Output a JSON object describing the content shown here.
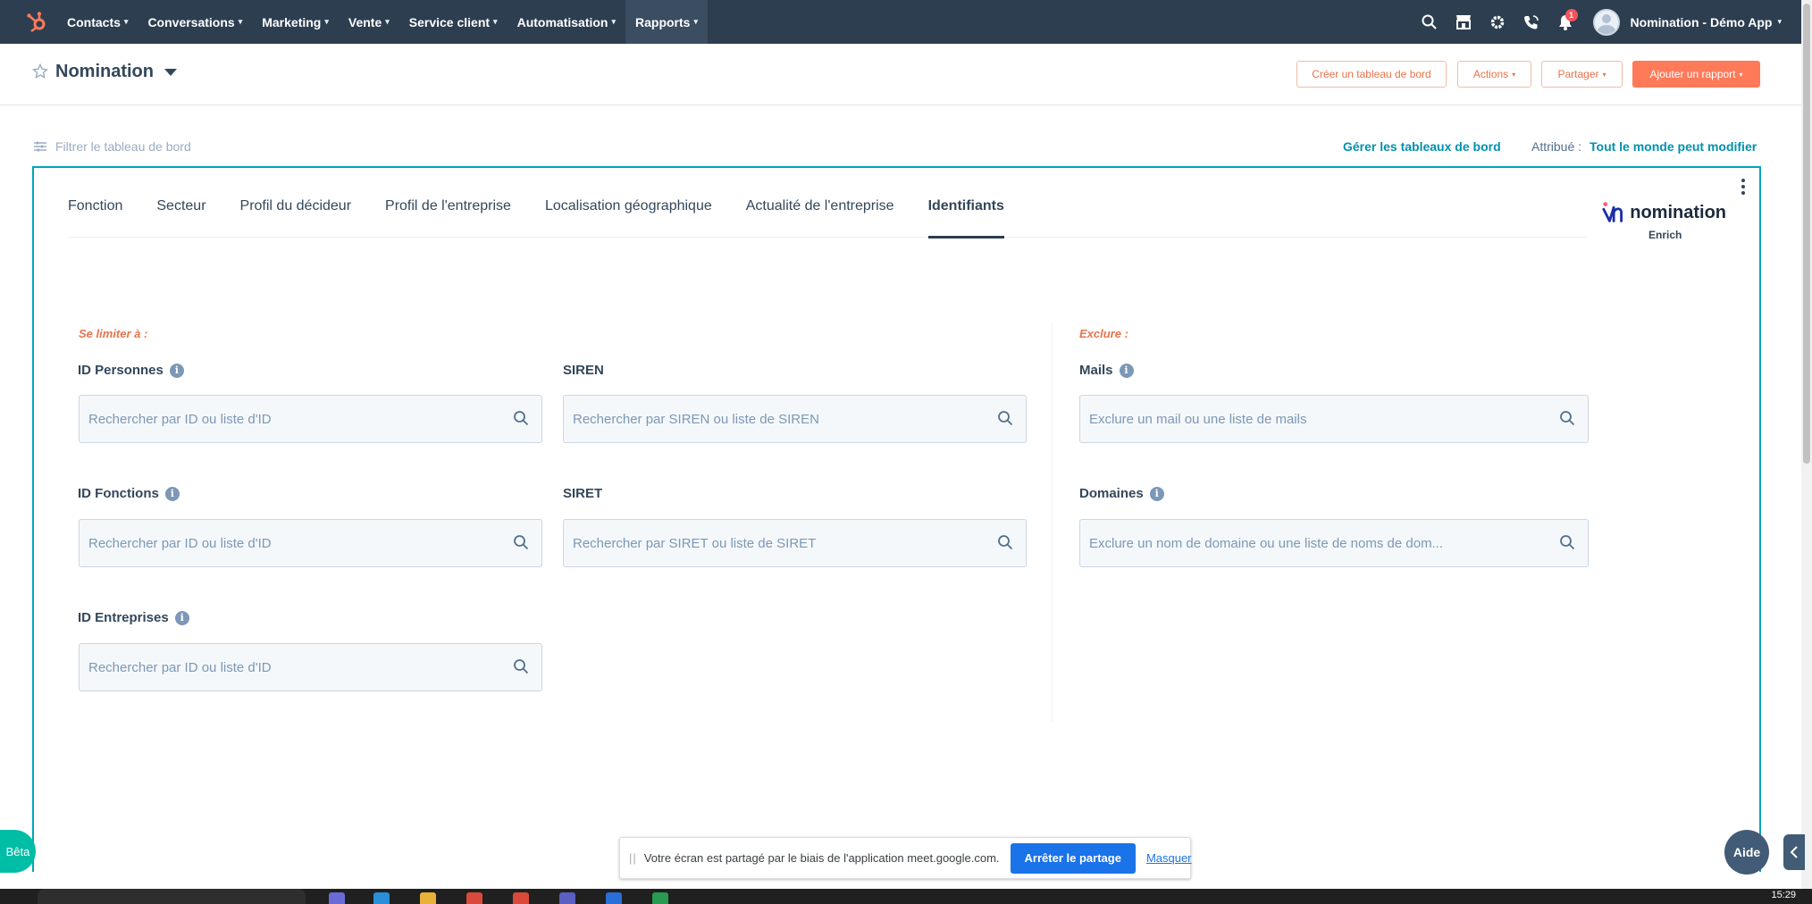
{
  "topnav": {
    "items": [
      {
        "label": "Contacts"
      },
      {
        "label": "Conversations"
      },
      {
        "label": "Marketing"
      },
      {
        "label": "Vente"
      },
      {
        "label": "Service client"
      },
      {
        "label": "Automatisation"
      },
      {
        "label": "Rapports"
      }
    ],
    "active_item": "Rapports",
    "notification_count": "1",
    "account_name": "Nomination - Démo App",
    "background": "#2d3e50"
  },
  "header": {
    "title": "Nomination",
    "buttons": {
      "create": "Créer un tableau de bord",
      "actions": "Actions",
      "share": "Partager",
      "add_report": "Ajouter un rapport"
    },
    "accent": "#ff7a59"
  },
  "filter_row": {
    "filter_label": "Filtrer le tableau de bord",
    "manage_link": "Gérer les tableaux de bord",
    "assigned_label": "Attribué :",
    "assigned_value": "Tout le monde peut modifier"
  },
  "card": {
    "tabs": [
      {
        "label": "Fonction"
      },
      {
        "label": "Secteur"
      },
      {
        "label": "Profil du décideur"
      },
      {
        "label": "Profil de l'entreprise"
      },
      {
        "label": "Localisation géographique"
      },
      {
        "label": "Actualité de l'entreprise"
      },
      {
        "label": "Identifiants"
      }
    ],
    "active_tab": "Identifiants",
    "brand": {
      "name": "nomination",
      "sub": "Enrich"
    },
    "include_label": "Se limiter à :",
    "exclude_label": "Exclure :",
    "fields": {
      "id_personnes": {
        "label": "ID Personnes",
        "placeholder": "Rechercher par ID ou liste d'ID"
      },
      "id_fonctions": {
        "label": "ID Fonctions",
        "placeholder": "Rechercher par ID ou liste d'ID"
      },
      "id_entreprises": {
        "label": "ID Entreprises",
        "placeholder": "Rechercher par ID ou liste d'ID"
      },
      "siren": {
        "label": "SIREN",
        "placeholder": "Rechercher par SIREN ou liste de SIREN"
      },
      "siret": {
        "label": "SIRET",
        "placeholder": "Rechercher par SIRET ou liste de SIRET"
      },
      "mails": {
        "label": "Mails",
        "placeholder": "Exclure un mail ou une liste de mails"
      },
      "domaines": {
        "label": "Domaines",
        "placeholder": "Exclure un nom de domaine ou une liste de noms de dom..."
      }
    }
  },
  "share_bar": {
    "text": "Votre écran est partagé par le biais de l'application meet.google.com.",
    "stop_label": "Arrêter le partage",
    "hide_label": "Masquer"
  },
  "beta_label": "Bêta",
  "help_label": "Aide",
  "taskbar": {
    "clock": "15:29"
  }
}
